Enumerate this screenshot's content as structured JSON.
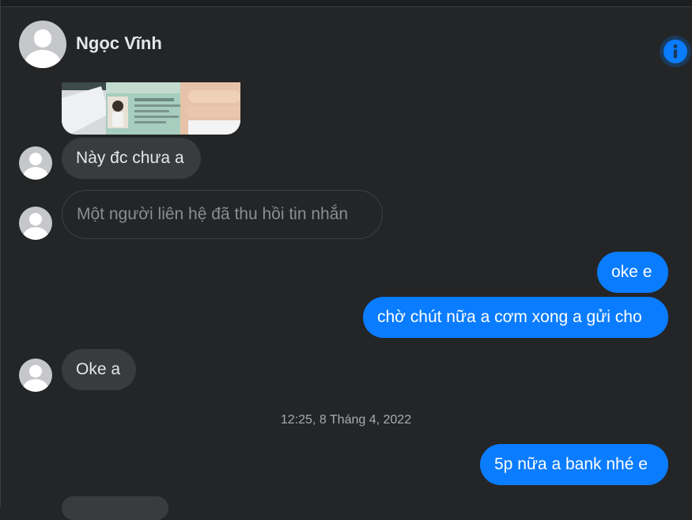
{
  "contact": {
    "name": "Ngọc Vĩnh",
    "info_icon": "info-icon"
  },
  "messages": [
    {
      "type": "image",
      "direction": "incoming",
      "image": "id-card-photo"
    },
    {
      "type": "text",
      "direction": "incoming",
      "text": "Này đc chưa a"
    },
    {
      "type": "retracted",
      "direction": "incoming",
      "text": "Một người liên hệ đã thu hồi tin nhắn"
    },
    {
      "type": "text",
      "direction": "outgoing",
      "text": "oke e"
    },
    {
      "type": "text",
      "direction": "outgoing",
      "text": "chờ chút nữa a cơm xong a gửi cho"
    },
    {
      "type": "text",
      "direction": "incoming",
      "text": "Oke a"
    },
    {
      "type": "timestamp",
      "text": "12:25, 8 Tháng 4, 2022"
    },
    {
      "type": "text",
      "direction": "outgoing",
      "text": "5p nữa a bank nhé e"
    }
  ],
  "colors": {
    "background": "#242526",
    "incoming_bubble": "#3a3b3c",
    "outgoing_bubble": "#0a7cff",
    "accent": "#0a7cff"
  }
}
